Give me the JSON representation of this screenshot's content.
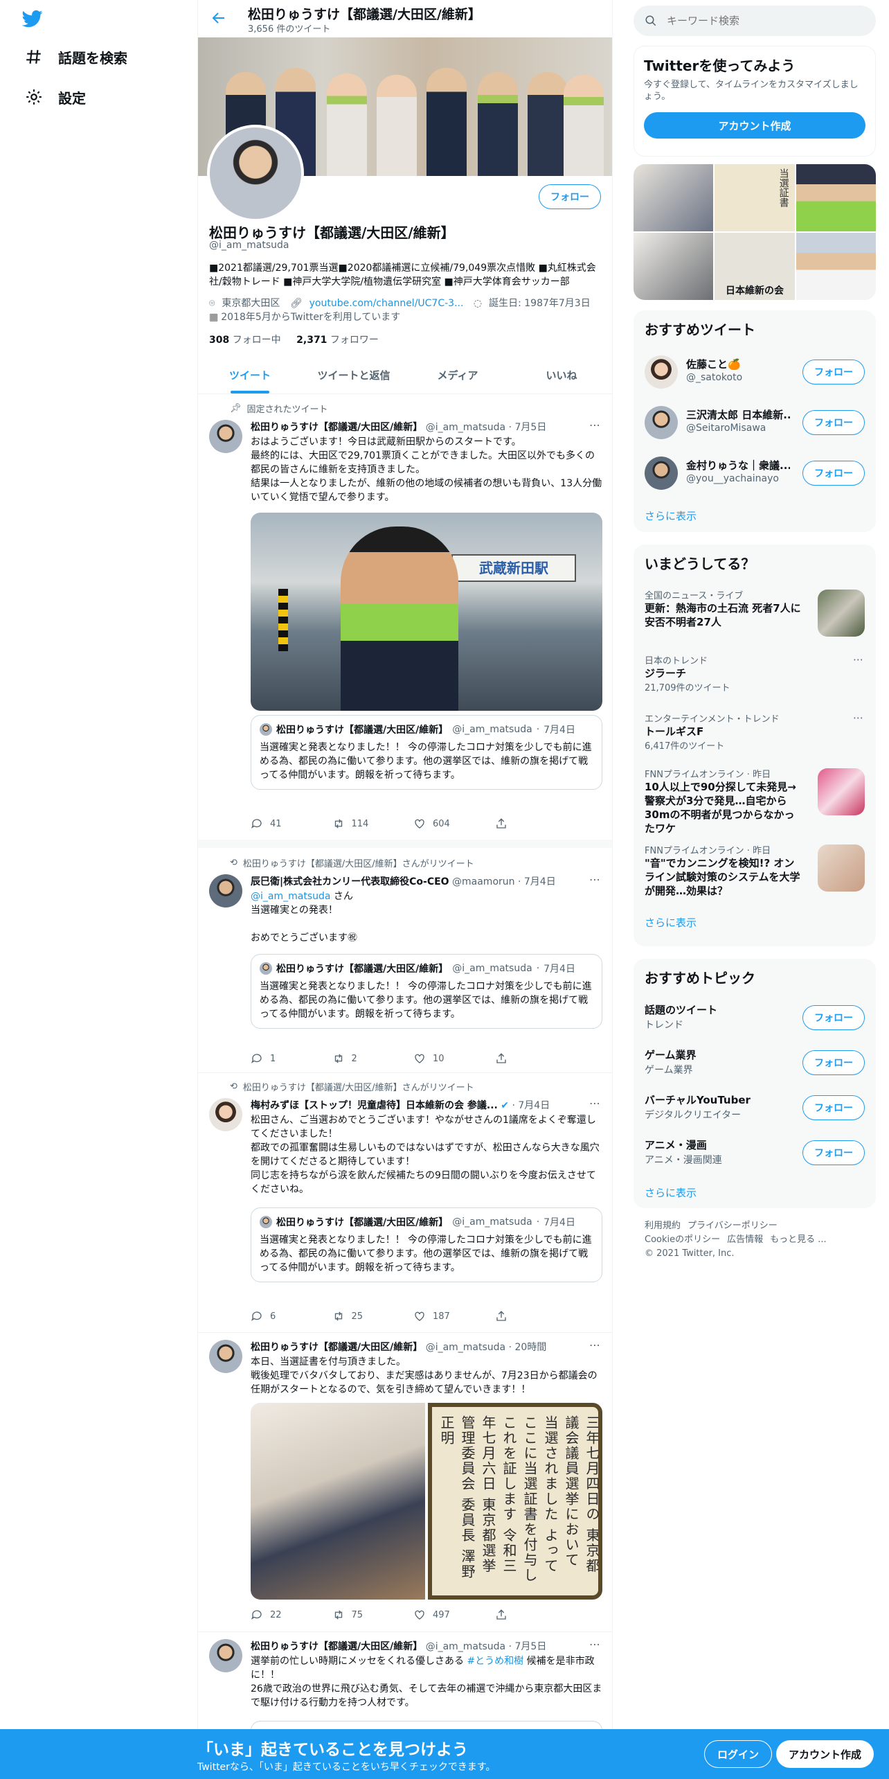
{
  "nav": {
    "items": [
      {
        "label": "話題を検索",
        "icon": "hashtag-icon"
      },
      {
        "label": "設定",
        "icon": "gear-icon"
      }
    ]
  },
  "header": {
    "name": "松田りゅうすけ【都議選/大田区/維新】",
    "tweet_count": "3,656 件のツイート"
  },
  "profile": {
    "name": "松田りゅうすけ【都議選/大田区/維新】",
    "handle": "@i_am_matsuda",
    "follow_label": "フォロー",
    "bio": "■2021都議選/29,701票当選■2020都議補選に立候補/79,049票次点惜敗 ■丸紅株式会社/穀物トレード ■神戸大学大学院/植物遺伝学研究室 ■神戸大学体育会サッカー部",
    "location": "東京都大田区",
    "url": "youtube.com/channel/UC7C-3...",
    "birthday": "誕生日: 1987年7月3日",
    "joined": "2018年5月からTwitterを利用しています",
    "following_count": "308",
    "following_label": "フォロー中",
    "followers_count": "2,371",
    "followers_label": "フォロワー"
  },
  "tabs": [
    "ツイート",
    "ツイートと返信",
    "メディア",
    "いいね"
  ],
  "tweets": [
    {
      "context": "固定されたツイート",
      "name": "松田りゅうすけ【都議選/大田区/維新】",
      "handle": "@i_am_matsuda",
      "date": "7月5日",
      "text": "おはようございます！今日は武蔵新田駅からのスタートです。\n最終的には、大田区で29,701票頂くことができました。大田区以外でも多くの都民の皆さんに維新を支持頂きました。\n結果は一人となりましたが、維新の他の地域の候補者の想いも背負い、13人分働いていく覚悟で望んで参ります。",
      "image_sign": "武蔵新田駅",
      "quote": {
        "name": "松田りゅうすけ【都議選/大田区/維新】",
        "handle": "@i_am_matsuda",
        "date": "7月4日",
        "text": "当選確実と発表となりました！！\n今の停滞したコロナ対策を少しでも前に進める為、都民の為に働いて参ります。他の選挙区では、維新の旗を掲げて戦ってる仲間がいます。朗報を祈って待ちます。"
      },
      "replies": "41",
      "retweets": "114",
      "likes": "604"
    },
    {
      "context": "松田りゅうすけ【都議選/大田区/維新】さんがリツイート",
      "name": "辰巳衛|株式会社カンリー代表取締役Co-CEO",
      "handle": "@maamorun",
      "date": "7月4日",
      "mention": "@i_am_matsuda",
      "text_after_mention": " さん\n当選確実との発表！\n\nおめでとうございます㊗",
      "quote": {
        "name": "松田りゅうすけ【都議選/大田区/維新】",
        "handle": "@i_am_matsuda",
        "date": "7月4日",
        "text": "当選確実と発表となりました！！\n今の停滞したコロナ対策を少しでも前に進める為、都民の為に働いて参ります。他の選挙区では、維新の旗を掲げて戦ってる仲間がいます。朗報を祈って待ちます。"
      },
      "replies": "1",
      "retweets": "2",
      "likes": "10"
    },
    {
      "context": "松田りゅうすけ【都議選/大田区/維新】さんがリツイート",
      "name": "梅村みずほ【ストップ！児童虐待】日本維新の会 参議...",
      "handle": "",
      "date": "7月4日",
      "text": "松田さん、ご当選おめでとうございます！やながせさんの1議席をよくぞ奪還してくださいました！\n都政での孤軍奮闘は生易しいものではないはずですが、松田さんなら大きな風穴を開けてくださると期待しています！\n同じ志を持ちながら涙を飲んだ候補たちの9日間の闘いぶりを今度お伝えさせてくださいね。",
      "quote": {
        "name": "松田りゅうすけ【都議選/大田区/維新】",
        "handle": "@i_am_matsuda",
        "date": "7月4日",
        "text": "当選確実と発表となりました！！\n今の停滞したコロナ対策を少しでも前に進める為、都民の為に働いて参ります。他の選挙区では、維新の旗を掲げて戦ってる仲間がいます。朗報を祈って待ちます。"
      },
      "replies": "6",
      "retweets": "25",
      "likes": "187"
    },
    {
      "name": "松田りゅうすけ【都議選/大田区/維新】",
      "handle": "@i_am_matsuda",
      "date": "20時間",
      "text": "本日、当選証書を付与頂きました。\n戦後処理でバタバタしており、まだ実感はありませんが、7月23日から都議会の任期がスタートとなるので、気を引き締めて望んでいきます！！",
      "certificate": "松田龍典\nあなたは令和三年七月四日の\n東京都議会議員選挙において\n当選されました\nよってここに当選証書を付与し\nこれを証します\n令和三年七月六日\n東京都選挙管理委員会\n委員長 澤野正明",
      "replies": "22",
      "retweets": "75",
      "likes": "497"
    },
    {
      "name": "松田りゅうすけ【都議選/大田区/維新】",
      "handle": "@i_am_matsuda",
      "date": "7月5日",
      "text_before_tag": "選挙前の忙しい時期にメッセをくれる優しさある ",
      "hashtag": "#とうめ和樹",
      "text_after_tag": " 候補を是非市政に！！\n26歳で政治の世界に飛び込む勇気、そして去年の補選で沖縄から東京都大田区まで駆け付ける行動力を持つ人材です。"
    }
  ],
  "sidebar": {
    "search_placeholder": "キーワード検索",
    "signup": {
      "title": "Twitterを使ってみよう",
      "text": "今すぐ登録して、タイムラインをカスタマイズしましょう。",
      "button": "アカウント作成"
    },
    "media_captions": [
      "日本維新の会",
      "当選証書"
    ],
    "who_to_follow": {
      "title": "おすすめツイート",
      "users": [
        {
          "name": "佐藤こと🍊",
          "handle": "@_satokoto"
        },
        {
          "name": "三沢清太郎 日本維新...",
          "handle": "@SeitaroMisawa"
        },
        {
          "name": "金村りゅうな｜衆議...",
          "handle": "@you__yachainayo"
        }
      ],
      "more": "さらに表示"
    },
    "trends": {
      "title": "いまどうしてる？",
      "items": [
        {
          "meta": "全国のニュース・ライブ",
          "title": "更新：熱海市の土石流 死者7人に 安否不明者27人",
          "count": ""
        },
        {
          "meta": "日本のトレンド",
          "title": "ジラーチ",
          "count": "21,709件のツイート"
        },
        {
          "meta": "エンターテインメント・トレンド",
          "title": "トールギスF",
          "count": "6,417件のツイート"
        },
        {
          "meta": "FNNプライムオンライン · 昨日",
          "title": "10人以上で90分探して未発見→警察犬が3分で発見…自宅から30mの不明者が見つからなかったワケ",
          "count": ""
        },
        {
          "meta": "FNNプライムオンライン · 昨日",
          "title": "\"音\"でカンニングを検知!? オンライン試験対策のシステムを大学が開発…効果は？",
          "count": ""
        }
      ],
      "more": "さらに表示"
    },
    "topics": {
      "title": "おすすめトピック",
      "items": [
        {
          "name": "話題のツイート",
          "sub": "トレンド"
        },
        {
          "name": "ゲーム業界",
          "sub": "ゲーム業界"
        },
        {
          "name": "バーチャルYouTuber",
          "sub": "デジタルクリエイター"
        },
        {
          "name": "アニメ・漫画",
          "sub": "アニメ・漫画関連"
        }
      ],
      "more": "さらに表示"
    },
    "footer": {
      "links": [
        "利用規約",
        "プライバシーポリシー",
        "Cookieのポリシー",
        "広告情報",
        "もっと見る ..."
      ],
      "copyright": "© 2021 Twitter, Inc."
    }
  },
  "bottom_bar": {
    "title": "「いま」起きていることを見つけよう",
    "subtitle": "Twitterなら、「いま」起きていることをいち早くチェックできます。",
    "login": "ログイン",
    "signup": "アカウント作成"
  },
  "colors": {
    "accent": "#1d9bf0",
    "text": "#0f1419",
    "muted": "#536471"
  }
}
